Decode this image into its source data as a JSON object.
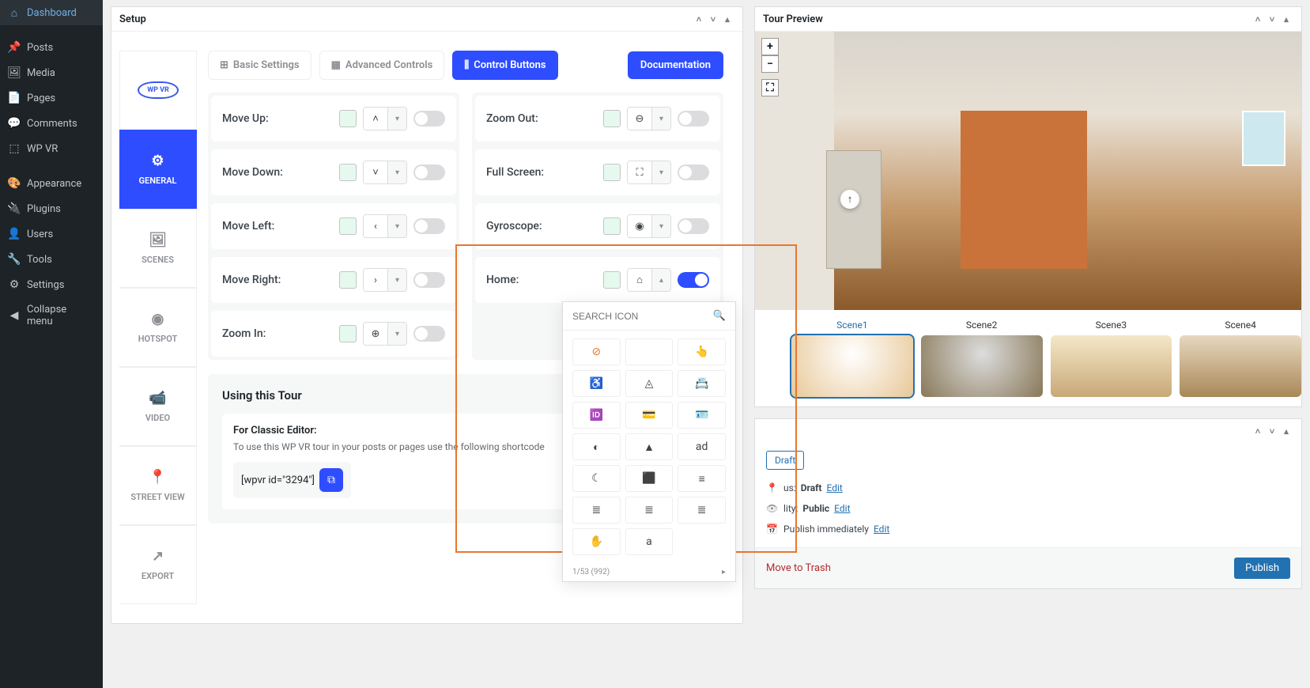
{
  "sidebar": {
    "items": [
      {
        "icon": "⌂",
        "label": "Dashboard"
      },
      {
        "icon": "📌",
        "label": "Posts"
      },
      {
        "icon": "🖼",
        "label": "Media"
      },
      {
        "icon": "📄",
        "label": "Pages"
      },
      {
        "icon": "💬",
        "label": "Comments"
      },
      {
        "icon": "⬚",
        "label": "WP VR"
      },
      {
        "icon": "🎨",
        "label": "Appearance"
      },
      {
        "icon": "🔌",
        "label": "Plugins"
      },
      {
        "icon": "👤",
        "label": "Users"
      },
      {
        "icon": "🔧",
        "label": "Tools"
      },
      {
        "icon": "⚙",
        "label": "Settings"
      },
      {
        "icon": "◀",
        "label": "Collapse menu"
      }
    ]
  },
  "setup": {
    "title": "Setup",
    "logo": "WP VR",
    "vtabs": [
      {
        "icon": "⚙",
        "label": "GENERAL"
      },
      {
        "icon": "🖼",
        "label": "SCENES"
      },
      {
        "icon": "◉",
        "label": "HOTSPOT"
      },
      {
        "icon": "📹",
        "label": "VIDEO"
      },
      {
        "icon": "📍",
        "label": "STREET VIEW"
      },
      {
        "icon": "↗",
        "label": "EXPORT"
      }
    ],
    "htabs": {
      "basic": "Basic Settings",
      "advanced": "Advanced Controls",
      "control": "Control Buttons"
    },
    "doc_btn": "Documentation",
    "controls_left": [
      {
        "label": "Move Up:",
        "icon": "˄"
      },
      {
        "label": "Move Down:",
        "icon": "˅"
      },
      {
        "label": "Move Left:",
        "icon": "‹"
      },
      {
        "label": "Move Right:",
        "icon": "›"
      },
      {
        "label": "Zoom In:",
        "icon": "+"
      }
    ],
    "controls_right": [
      {
        "label": "Zoom Out:",
        "icon": "−"
      },
      {
        "label": "Full Screen:",
        "icon": "⛶"
      },
      {
        "label": "Gyroscope:",
        "icon": "◉"
      },
      {
        "label": "Home:",
        "icon": "⌂"
      }
    ],
    "using": {
      "title": "Using this Tour",
      "sub": "For Classic Editor:",
      "desc": "To use this WP VR tour in your posts or pages use the following shortcode",
      "shortcode": "[wpvr id=\"3294\"]"
    },
    "picker": {
      "placeholder": "SEARCH ICON",
      "footer": "1/53 (992)"
    }
  },
  "preview": {
    "title": "Tour Preview",
    "scenes": [
      "Scene1",
      "Scene2",
      "Scene3",
      "Scene4"
    ]
  },
  "publish": {
    "save_draft": "Draft",
    "status_label": "us:",
    "status_value": "Draft",
    "visibility_label": "lity:",
    "visibility_value": "Public",
    "publish_label": "Publish immediately",
    "edit": "Edit",
    "trash": "Move to Trash",
    "publish_btn": "Publish"
  }
}
